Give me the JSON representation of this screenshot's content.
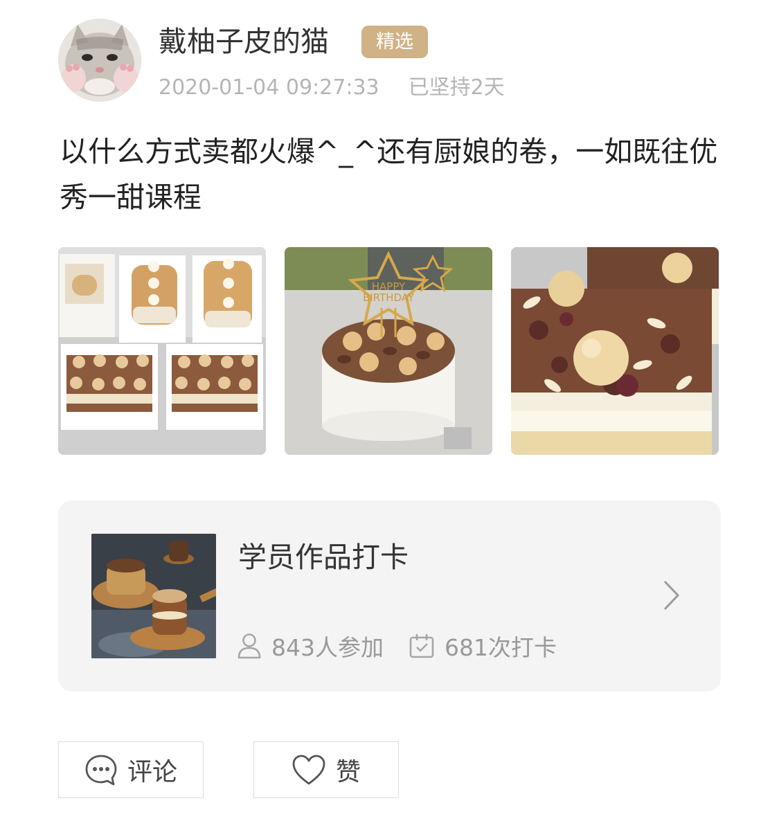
{
  "post": {
    "author": {
      "name": "戴柚子皮的猫",
      "avatar": "cat-avatar"
    },
    "badge": "精选",
    "timestamp": "2020-01-04 09:27:33",
    "streak": "已坚持2天",
    "text": "以什么方式卖都火爆^_^还有厨娘的卷，一如既往优秀一甜课程",
    "photos": [
      {
        "subject": "swiss-rolls-and-cake-slices"
      },
      {
        "subject": "happy-birthday-cake",
        "topper_text": "HAPPY BIRTHDAY"
      },
      {
        "subject": "nut-topped-box-cake"
      }
    ]
  },
  "course": {
    "title": "学员作品打卡",
    "participants": "843人参加",
    "checkins": "681次打卡",
    "icons": {
      "participants": "person-icon",
      "checkins": "calendar-check-icon",
      "chevron": "chevron-right-icon"
    }
  },
  "actions": {
    "comment_label": "评论",
    "like_label": "赞",
    "comment_icon": "comment-bubble-icon",
    "like_icon": "heart-icon"
  },
  "colors": {
    "badge": "#cfb285",
    "meta_text": "#b5b5b5",
    "card_bg": "#f4f4f4",
    "stat_text": "#999999"
  }
}
